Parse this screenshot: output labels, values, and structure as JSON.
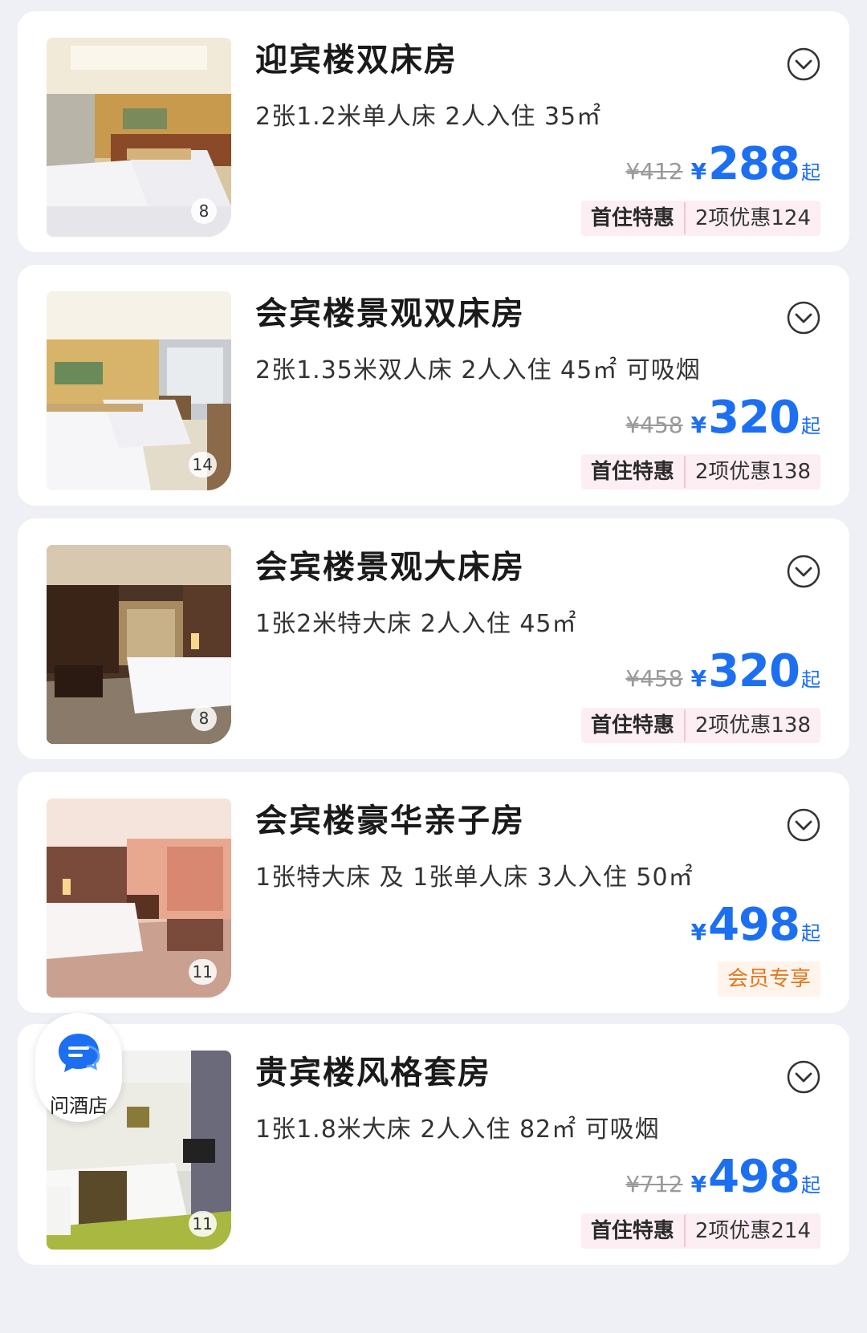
{
  "rooms": [
    {
      "name": "迎宾楼双床房",
      "spec": "2张1.2米单人床  2人入住  35㎡",
      "photo_count": "8",
      "original_price": "¥412",
      "currency": "¥",
      "price": "288",
      "price_suffix": "起",
      "promo_label": "首住特惠",
      "promo_detail": "2项优惠124"
    },
    {
      "name": "会宾楼景观双床房",
      "spec": "2张1.35米双人床  2人入住  45㎡  可吸烟",
      "photo_count": "14",
      "original_price": "¥458",
      "currency": "¥",
      "price": "320",
      "price_suffix": "起",
      "promo_label": "首住特惠",
      "promo_detail": "2项优惠138"
    },
    {
      "name": "会宾楼景观大床房",
      "spec": "1张2米特大床  2人入住  45㎡",
      "photo_count": "8",
      "original_price": "¥458",
      "currency": "¥",
      "price": "320",
      "price_suffix": "起",
      "promo_label": "首住特惠",
      "promo_detail": "2项优惠138"
    },
    {
      "name": "会宾楼豪华亲子房",
      "spec": "1张特大床 及 1张单人床  3人入住  50㎡",
      "photo_count": "11",
      "currency": "¥",
      "price": "498",
      "price_suffix": "起",
      "member_tag": "会员专享"
    },
    {
      "name": "贵宾楼风格套房",
      "spec": "1张1.8米大床  2人入住  82㎡  可吸烟",
      "photo_count": "11",
      "original_price": "¥712",
      "currency": "¥",
      "price": "498",
      "price_suffix": "起",
      "promo_label": "首住特惠",
      "promo_detail": "2项优惠214"
    }
  ],
  "ask_hotel": {
    "label": "问酒店",
    "icon": "chat-bubble-icon"
  },
  "icons": {
    "expand": "chevron-down-circle-icon"
  },
  "colors": {
    "price_blue": "#1d6ff2",
    "promo_bg": "#fdeef3",
    "member_orange": "#e2781f",
    "page_bg": "#eef0f6"
  }
}
